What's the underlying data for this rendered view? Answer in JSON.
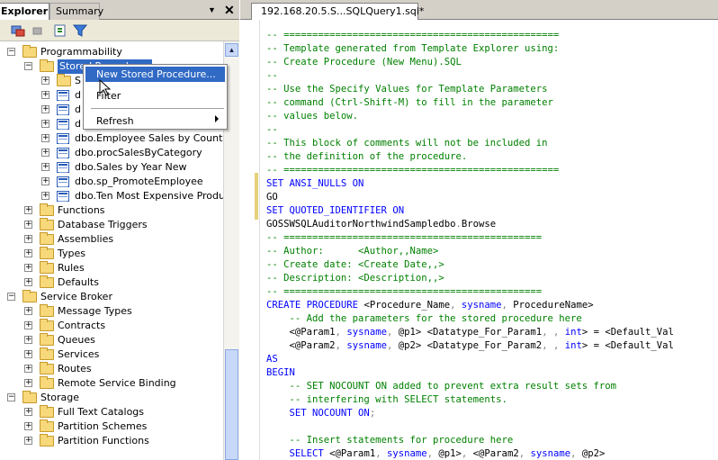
{
  "left_panel": {
    "tab_explorer": "Explorer",
    "tab_summary": "Summary"
  },
  "tree": [
    {
      "label": "Programmability",
      "level": 0,
      "type": "folder",
      "exp": "−"
    },
    {
      "label": "Stored Procedures",
      "level": 1,
      "type": "folder",
      "exp": "−",
      "selected": true
    },
    {
      "label": "S",
      "level": 2,
      "type": "folder",
      "exp": "+"
    },
    {
      "label": "d",
      "level": 2,
      "type": "proc",
      "exp": "+"
    },
    {
      "label": "d",
      "level": 2,
      "type": "proc",
      "exp": "+"
    },
    {
      "label": "d",
      "level": 2,
      "type": "proc",
      "exp": "+"
    },
    {
      "label": "dbo.Employee Sales by Country",
      "level": 2,
      "type": "proc",
      "exp": "+"
    },
    {
      "label": "dbo.procSalesByCategory",
      "level": 2,
      "type": "proc",
      "exp": "+"
    },
    {
      "label": "dbo.Sales by Year New",
      "level": 2,
      "type": "proc",
      "exp": "+"
    },
    {
      "label": "dbo.sp_PromoteEmployee",
      "level": 2,
      "type": "proc",
      "exp": "+"
    },
    {
      "label": "dbo.Ten Most Expensive Products",
      "level": 2,
      "type": "proc",
      "exp": "+"
    },
    {
      "label": "Functions",
      "level": 1,
      "type": "folder",
      "exp": "+"
    },
    {
      "label": "Database Triggers",
      "level": 1,
      "type": "folder",
      "exp": "+"
    },
    {
      "label": "Assemblies",
      "level": 1,
      "type": "folder",
      "exp": "+"
    },
    {
      "label": "Types",
      "level": 1,
      "type": "folder",
      "exp": "+"
    },
    {
      "label": "Rules",
      "level": 1,
      "type": "folder",
      "exp": "+"
    },
    {
      "label": "Defaults",
      "level": 1,
      "type": "folder",
      "exp": "+"
    },
    {
      "label": "Service Broker",
      "level": 0,
      "type": "folder",
      "exp": "−"
    },
    {
      "label": "Message Types",
      "level": 1,
      "type": "folder",
      "exp": "+"
    },
    {
      "label": "Contracts",
      "level": 1,
      "type": "folder",
      "exp": "+"
    },
    {
      "label": "Queues",
      "level": 1,
      "type": "folder",
      "exp": "+"
    },
    {
      "label": "Services",
      "level": 1,
      "type": "folder",
      "exp": "+"
    },
    {
      "label": "Routes",
      "level": 1,
      "type": "folder",
      "exp": "+"
    },
    {
      "label": "Remote Service Binding",
      "level": 1,
      "type": "folder",
      "exp": "+"
    },
    {
      "label": "Storage",
      "level": 0,
      "type": "folder",
      "exp": "−"
    },
    {
      "label": "Full Text Catalogs",
      "level": 1,
      "type": "folder",
      "exp": "+"
    },
    {
      "label": "Partition Schemes",
      "level": 1,
      "type": "folder",
      "exp": "+"
    },
    {
      "label": "Partition Functions",
      "level": 1,
      "type": "folder",
      "exp": "+"
    }
  ],
  "context_menu": {
    "new_proc": "New Stored Procedure...",
    "filter": "Filter",
    "refresh": "Refresh"
  },
  "editor": {
    "tab": "192.168.20.5.S...SQLQuery1.sql*"
  },
  "code_lines": [
    [
      [
        "c",
        "-- ================================================"
      ]
    ],
    [
      [
        "c",
        "-- Template generated from Template Explorer using:"
      ]
    ],
    [
      [
        "c",
        "-- Create Procedure (New Menu).SQL"
      ]
    ],
    [
      [
        "c",
        "--"
      ]
    ],
    [
      [
        "c",
        "-- Use the Specify Values for Template Parameters"
      ]
    ],
    [
      [
        "c",
        "-- command (Ctrl-Shift-M) to fill in the parameter"
      ]
    ],
    [
      [
        "c",
        "-- values below."
      ]
    ],
    [
      [
        "c",
        "--"
      ]
    ],
    [
      [
        "c",
        "-- This block of comments will not be included in"
      ]
    ],
    [
      [
        "c",
        "-- the definition of the procedure."
      ]
    ],
    [
      [
        "c",
        "-- ================================================"
      ]
    ],
    [
      [
        "k",
        "SET ANSI_NULLS ON"
      ]
    ],
    [
      [
        "t",
        "GO"
      ]
    ],
    [
      [
        "k",
        "SET QUOTED_IDENTIFIER ON"
      ]
    ],
    [
      [
        "t",
        "GOSSWSQLAuditorNorthwindSampledbo"
      ],
      [
        "g",
        "."
      ],
      [
        "t",
        "Browse"
      ]
    ],
    [
      [
        "c",
        "-- ============================================="
      ]
    ],
    [
      [
        "c",
        "-- Author:      <Author,,Name>"
      ]
    ],
    [
      [
        "c",
        "-- Create date: <Create Date,,>"
      ]
    ],
    [
      [
        "c",
        "-- Description: <Description,,>"
      ]
    ],
    [
      [
        "c",
        "-- ============================================="
      ]
    ],
    [
      [
        "k",
        "CREATE PROCEDURE "
      ],
      [
        "t",
        "<Procedure_Name"
      ],
      [
        "g",
        ", "
      ],
      [
        "i",
        "sysname"
      ],
      [
        "g",
        ", "
      ],
      [
        "t",
        "ProcedureName>"
      ]
    ],
    [
      [
        "t",
        "    "
      ],
      [
        "c",
        "-- Add the parameters for the stored procedure here"
      ]
    ],
    [
      [
        "t",
        "    <@Param1"
      ],
      [
        "g",
        ", "
      ],
      [
        "i",
        "sysname"
      ],
      [
        "g",
        ", "
      ],
      [
        "t",
        "@p1> <Datatype_For_Param1"
      ],
      [
        "g",
        ", , "
      ],
      [
        "i",
        "int"
      ],
      [
        "t",
        "> = <Default_Val"
      ]
    ],
    [
      [
        "t",
        "    <@Param2"
      ],
      [
        "g",
        ", "
      ],
      [
        "i",
        "sysname"
      ],
      [
        "g",
        ", "
      ],
      [
        "t",
        "@p2> <Datatype_For_Param2"
      ],
      [
        "g",
        ", , "
      ],
      [
        "i",
        "int"
      ],
      [
        "t",
        "> = <Default_Val"
      ]
    ],
    [
      [
        "k",
        "AS"
      ]
    ],
    [
      [
        "k",
        "BEGIN"
      ]
    ],
    [
      [
        "t",
        "    "
      ],
      [
        "c",
        "-- SET NOCOUNT ON added to prevent extra result sets from"
      ]
    ],
    [
      [
        "t",
        "    "
      ],
      [
        "c",
        "-- interfering with SELECT statements."
      ]
    ],
    [
      [
        "t",
        "    "
      ],
      [
        "k",
        "SET NOCOUNT ON"
      ],
      [
        "g",
        ";"
      ]
    ],
    [
      [
        "t",
        ""
      ]
    ],
    [
      [
        "t",
        "    "
      ],
      [
        "c",
        "-- Insert statements for procedure here"
      ]
    ],
    [
      [
        "t",
        "    "
      ],
      [
        "k",
        "SELECT "
      ],
      [
        "t",
        "<@Param1"
      ],
      [
        "g",
        ", "
      ],
      [
        "i",
        "sysname"
      ],
      [
        "g",
        ", "
      ],
      [
        "t",
        "@p1>"
      ],
      [
        "g",
        ", "
      ],
      [
        "t",
        "<@Param2"
      ],
      [
        "g",
        ", "
      ],
      [
        "i",
        "sysname"
      ],
      [
        "g",
        ", "
      ],
      [
        "t",
        "@p2>"
      ]
    ]
  ]
}
